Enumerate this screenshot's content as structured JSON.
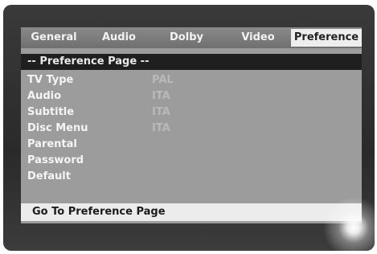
{
  "tabs": [
    {
      "label": "General"
    },
    {
      "label": "Audio"
    },
    {
      "label": "Dolby"
    },
    {
      "label": "Video"
    },
    {
      "label": "Preference"
    }
  ],
  "active_tab": "Preference",
  "page_heading": "-- Preference Page --",
  "settings": [
    {
      "label": "TV Type",
      "value": "PAL"
    },
    {
      "label": "Audio",
      "value": "ITA"
    },
    {
      "label": "Subtitle",
      "value": "ITA"
    },
    {
      "label": "Disc Menu",
      "value": "ITA"
    },
    {
      "label": "Parental",
      "value": ""
    },
    {
      "label": "Password",
      "value": ""
    },
    {
      "label": "Default",
      "value": ""
    }
  ],
  "status_text": "Go To Preference Page",
  "colors": {
    "menu_background": "#9c9c9c",
    "tab_bar": "#777777",
    "active_tab": "#eeeeee",
    "heading_bar": "#1f1f1f",
    "status_bar": "#ececec",
    "value_text": "#b9b9b9"
  }
}
